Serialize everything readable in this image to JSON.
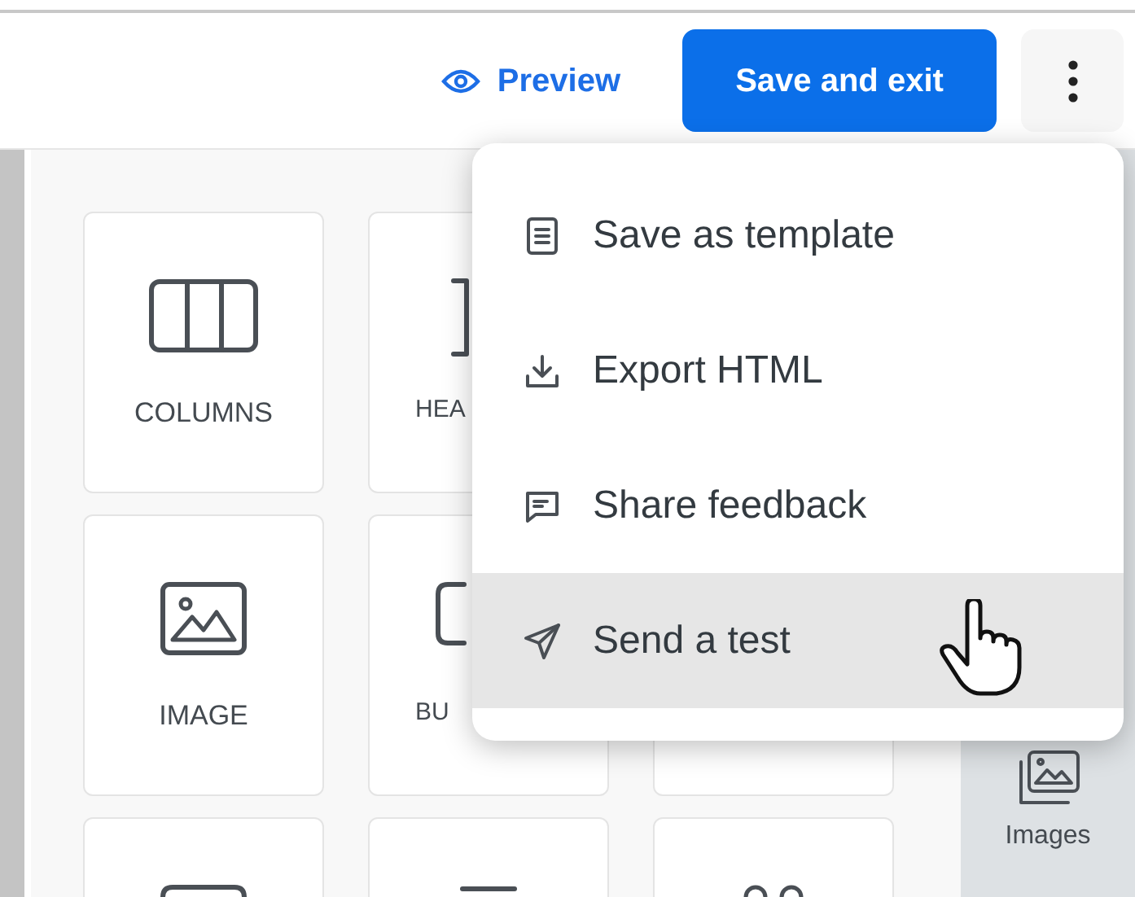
{
  "toolbar": {
    "preview": "Preview",
    "save": "Save and exit"
  },
  "block_rows": [
    {
      "blocks": [
        {
          "kind": "tile",
          "label": "COLUMNS"
        },
        {
          "kind": "covered",
          "label": "HEA"
        }
      ]
    },
    {
      "blocks": [
        {
          "kind": "tile",
          "label": "IMAGE"
        },
        {
          "kind": "covered",
          "label": "BU"
        },
        {
          "kind": "covered"
        }
      ]
    },
    {
      "blocks": [
        {
          "kind": "tile"
        },
        {
          "kind": "tile"
        },
        {
          "kind": "tile"
        }
      ]
    }
  ],
  "sidebar": {
    "items": [
      {
        "label": "Images"
      }
    ]
  },
  "menu": {
    "items": [
      {
        "label": "Save as template",
        "selected": false
      },
      {
        "label": "Export HTML",
        "selected": false
      },
      {
        "label": "Share feedback",
        "selected": false
      },
      {
        "label": "Send a test",
        "selected": true
      }
    ]
  }
}
